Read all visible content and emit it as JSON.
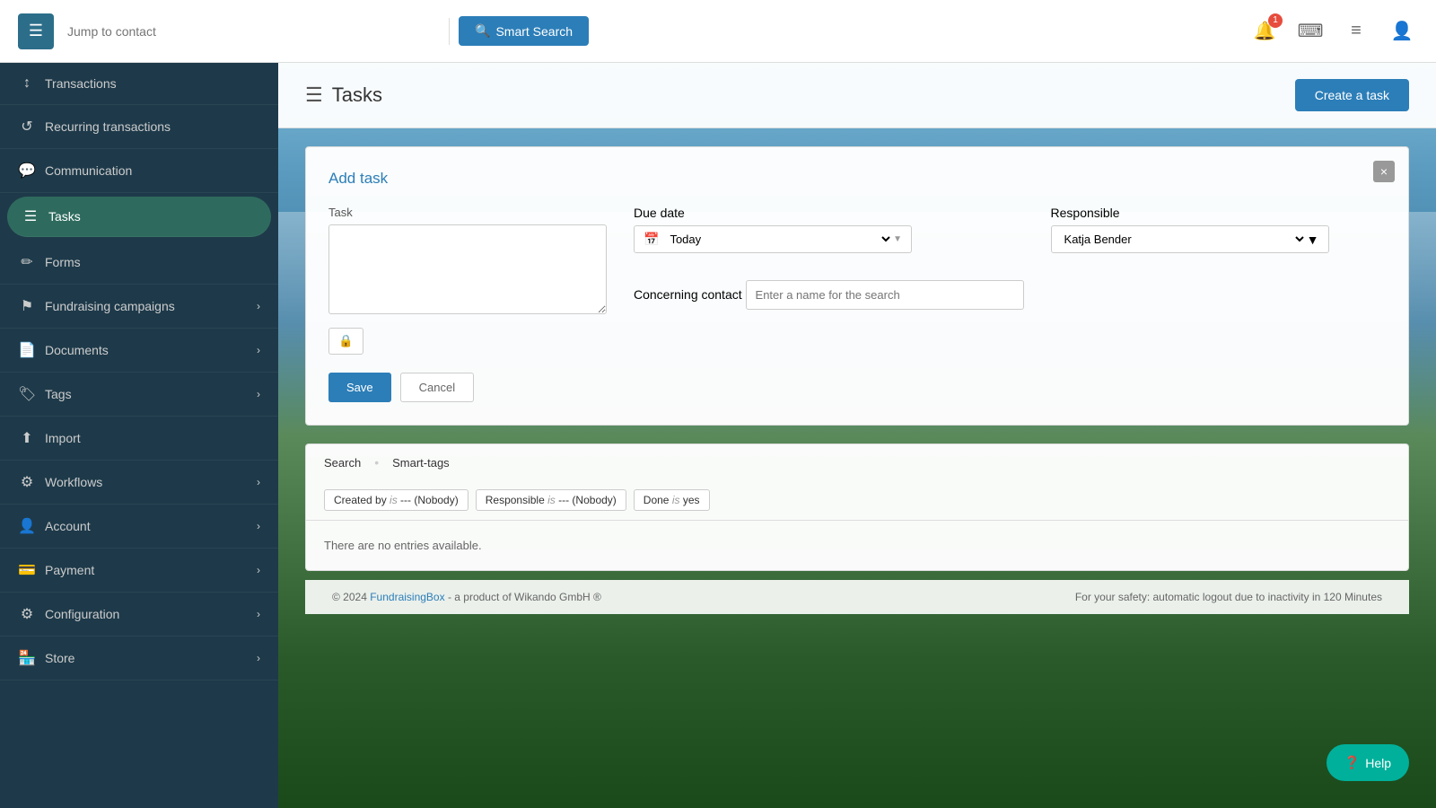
{
  "topNav": {
    "hamburger_label": "☰",
    "search_placeholder": "Jump to contact",
    "smart_search_label": "Smart Search",
    "smart_search_icon": "🔍",
    "notification_count": "1"
  },
  "sidebar": {
    "items": [
      {
        "id": "transactions",
        "label": "Transactions",
        "icon": "↕",
        "active": false,
        "has_chevron": false
      },
      {
        "id": "recurring-transactions",
        "label": "Recurring transactions",
        "icon": "↺",
        "active": false,
        "has_chevron": false
      },
      {
        "id": "communication",
        "label": "Communication",
        "icon": "💬",
        "active": false,
        "has_chevron": false
      },
      {
        "id": "tasks",
        "label": "Tasks",
        "icon": "☰",
        "active": true,
        "has_chevron": false
      },
      {
        "id": "forms",
        "label": "Forms",
        "icon": "✏",
        "active": false,
        "has_chevron": false
      },
      {
        "id": "fundraising-campaigns",
        "label": "Fundraising campaigns",
        "icon": "⚑",
        "active": false,
        "has_chevron": true
      },
      {
        "id": "documents",
        "label": "Documents",
        "icon": "📄",
        "active": false,
        "has_chevron": true
      },
      {
        "id": "tags",
        "label": "Tags",
        "icon": "🏷",
        "active": false,
        "has_chevron": true
      },
      {
        "id": "import",
        "label": "Import",
        "icon": "⬆",
        "active": false,
        "has_chevron": false
      },
      {
        "id": "workflows",
        "label": "Workflows",
        "icon": "⚙",
        "active": false,
        "has_chevron": true
      },
      {
        "id": "account",
        "label": "Account",
        "icon": "👤",
        "active": false,
        "has_chevron": true
      },
      {
        "id": "payment",
        "label": "Payment",
        "icon": "💳",
        "active": false,
        "has_chevron": true
      },
      {
        "id": "configuration",
        "label": "Configuration",
        "icon": "⚙",
        "active": false,
        "has_chevron": true
      },
      {
        "id": "store",
        "label": "Store",
        "icon": "🏪",
        "active": false,
        "has_chevron": true
      }
    ]
  },
  "tasksPage": {
    "title": "Tasks",
    "create_task_label": "Create a task",
    "addTask": {
      "title": "Add task",
      "task_label": "Task",
      "task_placeholder": "",
      "due_date_label": "Due date",
      "due_date_value": "Today",
      "responsible_label": "Responsible",
      "responsible_value": "Katja Bender",
      "concerning_contact_label": "Concerning contact",
      "concerning_contact_placeholder": "Enter a name for the search",
      "save_label": "Save",
      "cancel_label": "Cancel"
    },
    "filterBar": {
      "search_label": "Search",
      "smart_tags_label": "Smart-tags"
    },
    "filters": [
      {
        "key": "Created by",
        "op": "is",
        "val": "--- (Nobody)"
      },
      {
        "key": "Responsible",
        "op": "is",
        "val": "--- (Nobody)"
      },
      {
        "key": "Done",
        "op": "is",
        "val": "yes"
      }
    ],
    "empty_state": "There are no entries available."
  },
  "footer": {
    "copyright": "© 2024 ",
    "brand_link": "FundraisingBox",
    "brand_suffix": " - a product of Wikando GmbH ®",
    "safety_notice": "For your safety: automatic logout due to inactivity in 120 Minutes"
  },
  "help": {
    "label": "Help",
    "icon": "?"
  }
}
